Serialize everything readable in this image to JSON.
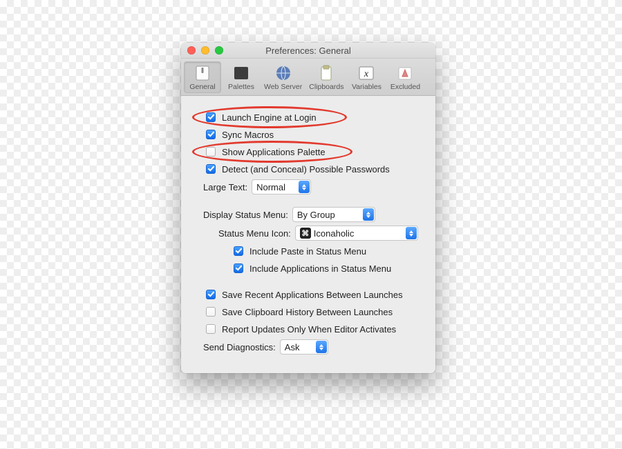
{
  "window": {
    "title": "Preferences: General"
  },
  "toolbar": {
    "items": [
      {
        "label": "General",
        "selected": true
      },
      {
        "label": "Palettes",
        "selected": false
      },
      {
        "label": "Web Server",
        "selected": false
      },
      {
        "label": "Clipboards",
        "selected": false
      },
      {
        "label": "Variables",
        "selected": false
      },
      {
        "label": "Excluded",
        "selected": false
      }
    ]
  },
  "options": {
    "launch_engine": {
      "label": "Launch Engine at Login",
      "checked": true
    },
    "sync_macros": {
      "label": "Sync Macros",
      "checked": true
    },
    "show_apps_palette": {
      "label": "Show Applications Palette",
      "checked": false
    },
    "detect_passwords": {
      "label": "Detect (and Conceal) Possible Passwords",
      "checked": true
    },
    "large_text": {
      "label": "Large Text:",
      "value": "Normal"
    },
    "display_status_menu": {
      "label": "Display Status Menu:",
      "value": "By Group"
    },
    "status_menu_icon": {
      "label": "Status Menu Icon:",
      "value": "Iconaholic",
      "glyph": "⌘"
    },
    "include_paste": {
      "label": "Include Paste in Status Menu",
      "checked": true
    },
    "include_apps": {
      "label": "Include Applications in Status Menu",
      "checked": true
    },
    "save_recent_apps": {
      "label": "Save Recent Applications Between Launches",
      "checked": true
    },
    "save_clipboard": {
      "label": "Save Clipboard History Between Launches",
      "checked": false
    },
    "report_updates": {
      "label": "Report Updates Only When Editor Activates",
      "checked": false
    },
    "send_diagnostics": {
      "label": "Send Diagnostics:",
      "value": "Ask"
    }
  },
  "annotations": [
    {
      "target": "launch_engine"
    },
    {
      "target": "show_apps_palette"
    }
  ]
}
